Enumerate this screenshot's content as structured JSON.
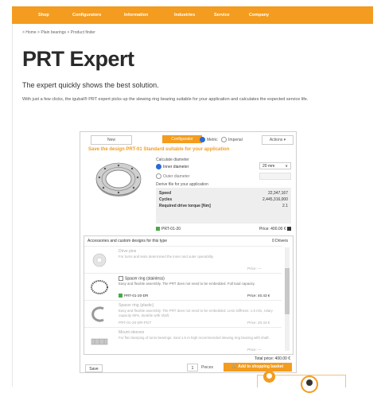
{
  "nav": {
    "items": [
      "Shop",
      "Configurators",
      "Information",
      "Industries",
      "Service",
      "Company"
    ],
    "color": "#f39c1f"
  },
  "breadcrumb": "> Home  > Plain bearings  > Product finder",
  "page": {
    "title": "PRT Expert",
    "subtitle": "The expert quickly shows the best solution.",
    "intro": "With just a few clicks, the igubal® PRT expert picks up the slewing ring bearing suitable for your application and calculates the expected service life."
  },
  "configurator": {
    "tabs": {
      "new": "New",
      "configurator": "Configurator"
    },
    "units": {
      "metric": "Metric",
      "imperial": "Imperial"
    },
    "actions_label": "Actions",
    "heading": "Save the design PRT-01 Standard suitable for your application",
    "calculate_title": "Calculate diameter",
    "option_inner": "Inner diameter",
    "option_outer": "Outer diameter",
    "select_value": "20 mm",
    "derive_label": "Derive file for your application",
    "results": [
      {
        "label": "Speed",
        "value": "22,347,167"
      },
      {
        "label": "Cycles",
        "value": "2,445,316,000"
      },
      {
        "label": "Required drive torque [Nm]",
        "value": "2.1"
      }
    ],
    "part_number": "PRT-01-20",
    "part_price": "Price: 400.00 €",
    "accessories_title": "Accessories and custom designs for this type",
    "accessories_right": "0 Drivers",
    "accessories": [
      {
        "title": "Drive pins",
        "desc": "For turns and tests determined the inner and outer operability",
        "pnum": "",
        "price": "Price: —",
        "faded": true
      },
      {
        "title": "Spacer ring (stainless)",
        "desc": "Easy and flexible assembly. The PRT does not need to be embedded. Full load capacity.",
        "pnum": "PRT-01-20-DR",
        "price": "Price: 40.43 €",
        "faded": false
      },
      {
        "title": "Spacer ring (plastic)",
        "desc": "Easy and flexible assembly. The PRT does not need to be embedded. Less stiffness: 1.5 m/s, rotary capacity 60%, durable with shaft.",
        "pnum": "PRT-01-20-DR-PGT",
        "price": "Price: 20.43 €",
        "faded": true
      },
      {
        "title": "Mount sleeves",
        "desc": "For flat clamping of turns bearings. Seal 1.6 m high recommended slewing ring bearing with shaft.",
        "pnum": "",
        "price": "Price: —",
        "faded": true
      }
    ],
    "total": "Total price: 400.00 €",
    "save_label": "Save",
    "quantity": "1",
    "quantity_label": "Pieces",
    "cart_label": "Add to shopping basket"
  }
}
